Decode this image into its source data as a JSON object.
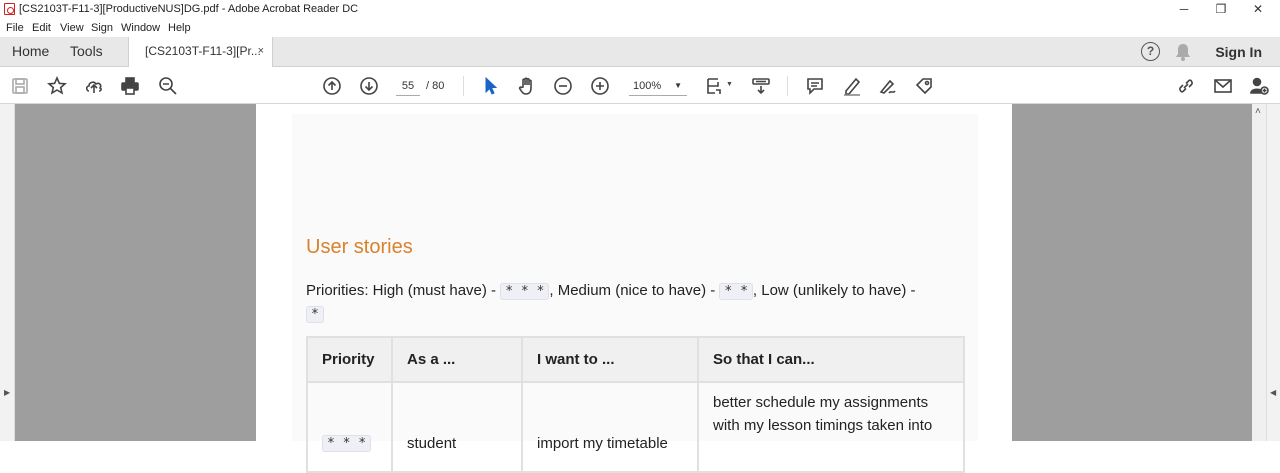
{
  "window": {
    "title": "[CS2103T-F11-3][ProductiveNUS]DG.pdf - Adobe Acrobat Reader DC",
    "minimize": "─",
    "restore": "❐",
    "close": "✕"
  },
  "menu": [
    "File",
    "Edit",
    "View",
    "Sign",
    "Window",
    "Help"
  ],
  "tabs": {
    "home": "Home",
    "tools": "Tools",
    "document": "[CS2103T-F11-3][Pr...",
    "close": "×",
    "sign_in": "Sign In"
  },
  "toolbar": {
    "page_current": "55",
    "page_total": "/ 80",
    "zoom": "100%"
  },
  "document": {
    "heading": "User stories",
    "priorities_text": "Priorities: High (must have) - ",
    "high_code": "* * *",
    "medium_text": ", Medium (nice to have) - ",
    "medium_code": "* *",
    "low_text": ", Low (unlikely to have) - ",
    "low_code": "*",
    "table": {
      "headers": [
        "Priority",
        "As a ...",
        "I want to ...",
        "So that I can..."
      ],
      "rows": [
        {
          "priority": "* * *",
          "as_a": "student",
          "want": "import my timetable",
          "so_that": "better schedule my assignments with my lesson timings taken into"
        }
      ]
    }
  },
  "colors": {
    "heading": "#d9822b",
    "canvas": "#9e9e9e",
    "accent_pointer": "#1a64c8"
  }
}
